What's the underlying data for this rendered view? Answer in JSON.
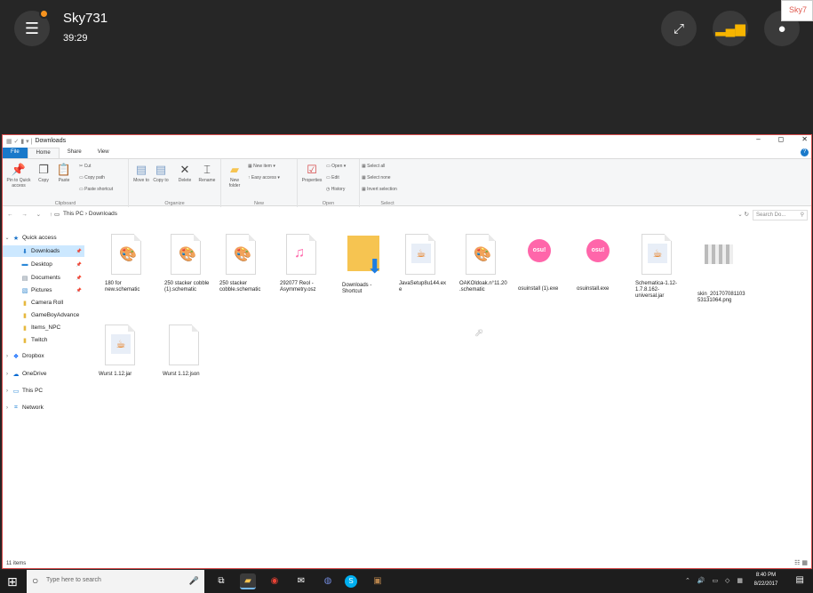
{
  "stream": {
    "name": "Sky731",
    "time": "39:29",
    "logo": "Sky7"
  },
  "window": {
    "title": "Downloads",
    "controls": [
      "–",
      "◻",
      "✕"
    ]
  },
  "tabs": [
    "File",
    "Home",
    "Share",
    "View"
  ],
  "ribbon": {
    "clipboard": {
      "title": "Clipboard",
      "pin": "Pin to Quick access",
      "copy": "Copy",
      "paste": "Paste",
      "cut": "Cut",
      "copy_path": "Copy path",
      "paste_shortcut": "Paste shortcut"
    },
    "organize": {
      "title": "Organize",
      "move_to": "Move to",
      "copy_to": "Copy to",
      "delete": "Delete",
      "rename": "Rename"
    },
    "new": {
      "title": "New",
      "new_folder": "New folder",
      "new_item": "New item",
      "easy_access": "Easy access"
    },
    "open": {
      "title": "Open",
      "properties": "Properties",
      "open": "Open",
      "edit": "Edit",
      "history": "History"
    },
    "select": {
      "title": "Select",
      "select_all": "Select all",
      "select_none": "Select none",
      "invert": "Invert selection"
    }
  },
  "address": {
    "path": "This PC  ›  Downloads",
    "search_placeholder": "Search Do..."
  },
  "nav": [
    {
      "label": "Quick access",
      "chev": "⌄",
      "icon": "★",
      "color": "#1a73c9"
    },
    {
      "label": "Downloads",
      "chev": "",
      "icon": "⬇",
      "color": "#1a73c9",
      "pin": true,
      "sel": true
    },
    {
      "label": "Desktop",
      "chev": "",
      "icon": "▬",
      "color": "#2b88d8",
      "pin": true
    },
    {
      "label": "Documents",
      "chev": "",
      "icon": "▤",
      "color": "#6a7b8c",
      "pin": true
    },
    {
      "label": "Pictures",
      "chev": "",
      "icon": "▧",
      "color": "#3c8dd0",
      "pin": true
    },
    {
      "label": "Camera Roll",
      "chev": "",
      "icon": "▮",
      "color": "#e6b83e"
    },
    {
      "label": "GameBoyAdvance",
      "chev": "",
      "icon": "▮",
      "color": "#e6b83e"
    },
    {
      "label": "Items_NPC",
      "chev": "",
      "icon": "▮",
      "color": "#e6b83e"
    },
    {
      "label": "Twitch",
      "chev": "",
      "icon": "▮",
      "color": "#e6b83e"
    },
    {
      "label": "Dropbox",
      "chev": "›",
      "icon": "❖",
      "color": "#0061fe"
    },
    {
      "label": "OneDrive",
      "chev": "›",
      "icon": "☁",
      "color": "#0a6bd3"
    },
    {
      "label": "This PC",
      "chev": "›",
      "icon": "▭",
      "color": "#2b88d8"
    },
    {
      "label": "Network",
      "chev": "›",
      "icon": "⌗",
      "color": "#2b88d8"
    }
  ],
  "files": [
    {
      "name": "180 for new.schematic",
      "kind": "paint"
    },
    {
      "name": "250 stacker cobble (1).schematic",
      "kind": "paint"
    },
    {
      "name": "250 stacker cobble.schematic",
      "kind": "paint"
    },
    {
      "name": "292077 Reol - Asymmetry.osz",
      "kind": "osz"
    },
    {
      "name": "Downloads - Shortcut",
      "kind": "folder"
    },
    {
      "name": "JavaSetup8u144.exe",
      "kind": "java"
    },
    {
      "name": "OAKOldoak.n°11.20.schematic",
      "kind": "paint"
    },
    {
      "name": "osuinstall (1).exe",
      "kind": "osu"
    },
    {
      "name": "osuinstall.exe",
      "kind": "osu"
    },
    {
      "name": "Schematica-1.12-1.7.8.162-universal.jar",
      "kind": "java"
    },
    {
      "name": "skin_20170708110353131064.png",
      "kind": "png"
    },
    {
      "name": "Wurst 1.12.jar",
      "kind": "java"
    },
    {
      "name": "Wurst 1.12.json",
      "kind": "doc"
    }
  ],
  "status": {
    "items": "11 items"
  },
  "taskbar": {
    "search_placeholder": "Type here to search",
    "time": "8:40 PM",
    "date": "8/22/2017"
  },
  "colors": {
    "accent": "#1979ca",
    "selection": "#cce8ff",
    "stream_bg": "#262626",
    "border": "#d64b4b"
  }
}
